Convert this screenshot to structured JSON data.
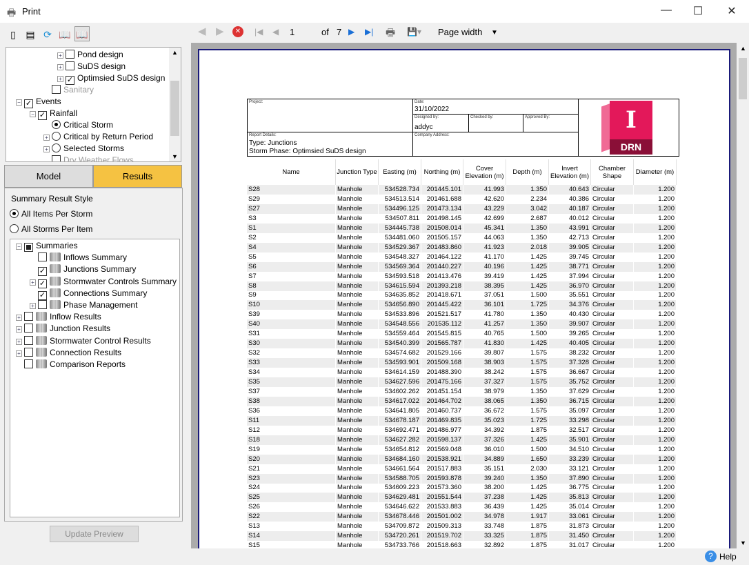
{
  "window": {
    "title": "Print",
    "minimize": "—",
    "maximize": "☐",
    "close": "✕"
  },
  "left_toolbar": {
    "icons": [
      "single-page-icon",
      "multi-page-icon",
      "refresh-icon",
      "book-map-icon",
      "book-icon"
    ]
  },
  "tree_top": [
    {
      "label": "Pond design",
      "checked": false,
      "expandable": true,
      "indent": 3
    },
    {
      "label": "SuDS design",
      "checked": false,
      "expandable": true,
      "indent": 3
    },
    {
      "label": "Optimsied SuDS design",
      "checked": true,
      "expandable": true,
      "indent": 3
    },
    {
      "label": "Sanitary",
      "checked": false,
      "expandable": false,
      "indent": 2,
      "disabled": true
    },
    {
      "label": "Events",
      "checked": true,
      "expandable": true,
      "expanded": true,
      "indent": 0
    },
    {
      "label": "Rainfall",
      "checked": true,
      "expandable": true,
      "expanded": true,
      "indent": 1
    },
    {
      "label": "Critical Storm",
      "radio": true,
      "selected": true,
      "indent": 2
    },
    {
      "label": "Critical by Return Period",
      "radio": true,
      "selected": false,
      "expandable": true,
      "indent": 2
    },
    {
      "label": "Selected Storms",
      "radio": true,
      "selected": false,
      "expandable": true,
      "indent": 2
    },
    {
      "label": "Dry Weather Flows",
      "checked": false,
      "indent": 2,
      "disabled": true
    }
  ],
  "tabs": {
    "model": "Model",
    "results": "Results",
    "active": "results",
    "active_color": "#f5c242"
  },
  "results_panel": {
    "style_label": "Summary Result Style",
    "options": [
      {
        "label": "All Items Per Storm",
        "selected": true
      },
      {
        "label": "All Storms Per Item",
        "selected": false
      }
    ],
    "tree": [
      {
        "label": "Summaries",
        "state": "partial",
        "expandable": true,
        "expanded": true,
        "indent": 0,
        "book": false
      },
      {
        "label": "Inflows Summary",
        "checked": false,
        "indent": 1,
        "book": true
      },
      {
        "label": "Junctions Summary",
        "checked": true,
        "indent": 1,
        "book": true
      },
      {
        "label": "Stormwater Controls Summary",
        "checked": true,
        "expandable": true,
        "indent": 1,
        "book": true
      },
      {
        "label": "Connections Summary",
        "checked": true,
        "indent": 1,
        "book": true
      },
      {
        "label": "Phase Management",
        "checked": false,
        "expandable": true,
        "indent": 1,
        "book": true
      },
      {
        "label": "Inflow Results",
        "checked": false,
        "expandable": true,
        "indent": 0,
        "book": true
      },
      {
        "label": "Junction Results",
        "checked": false,
        "expandable": true,
        "indent": 0,
        "book": true
      },
      {
        "label": "Stormwater Control Results",
        "checked": false,
        "expandable": true,
        "indent": 0,
        "book": true
      },
      {
        "label": "Connection Results",
        "checked": false,
        "expandable": true,
        "indent": 0,
        "book": true
      },
      {
        "label": "Comparison Reports",
        "checked": false,
        "indent": 0,
        "book": true
      }
    ],
    "update_button": "Update Preview"
  },
  "preview_toolbar": {
    "page": "1",
    "of_label": "of",
    "total_pages": "7",
    "zoom": "Page width"
  },
  "report": {
    "project_label": "Project:",
    "date_label": "Date:",
    "date": "31/10/2022",
    "designed_label": "Designed by:",
    "designed": "addyc",
    "checked_label": "Checked by:",
    "approved_label": "Approved By:",
    "details_label": "Report Details:",
    "type": "Type: Junctions",
    "phase": "Storm Phase: Optimsied SuDS design",
    "address_label": "Company Address:",
    "logo_letter": "I",
    "logo_text": "DRN",
    "logo_color": "#e3185a",
    "columns": [
      "Name",
      "Junction Type",
      "Easting (m)",
      "Northing (m)",
      "Cover Elevation (m)",
      "Depth (m)",
      "Invert Elevation (m)",
      "Chamber Shape",
      "Diameter (m)"
    ],
    "rows": [
      [
        "S28",
        "Manhole",
        "534528.734",
        "201445.101",
        "41.993",
        "1.350",
        "40.643",
        "Circular",
        "1.200"
      ],
      [
        "S29",
        "Manhole",
        "534513.514",
        "201461.688",
        "42.620",
        "2.234",
        "40.386",
        "Circular",
        "1.200"
      ],
      [
        "S27",
        "Manhole",
        "534496.125",
        "201473.134",
        "43.229",
        "3.042",
        "40.187",
        "Circular",
        "1.200"
      ],
      [
        "S3",
        "Manhole",
        "534507.811",
        "201498.145",
        "42.699",
        "2.687",
        "40.012",
        "Circular",
        "1.200"
      ],
      [
        "S1",
        "Manhole",
        "534445.738",
        "201508.014",
        "45.341",
        "1.350",
        "43.991",
        "Circular",
        "1.200"
      ],
      [
        "S2",
        "Manhole",
        "534481.060",
        "201505.157",
        "44.063",
        "1.350",
        "42.713",
        "Circular",
        "1.200"
      ],
      [
        "S4",
        "Manhole",
        "534529.367",
        "201483.860",
        "41.923",
        "2.018",
        "39.905",
        "Circular",
        "1.200"
      ],
      [
        "S5",
        "Manhole",
        "534548.327",
        "201464.122",
        "41.170",
        "1.425",
        "39.745",
        "Circular",
        "1.200"
      ],
      [
        "S6",
        "Manhole",
        "534569.364",
        "201440.227",
        "40.196",
        "1.425",
        "38.771",
        "Circular",
        "1.200"
      ],
      [
        "S7",
        "Manhole",
        "534593.518",
        "201413.476",
        "39.419",
        "1.425",
        "37.994",
        "Circular",
        "1.200"
      ],
      [
        "S8",
        "Manhole",
        "534615.594",
        "201393.218",
        "38.395",
        "1.425",
        "36.970",
        "Circular",
        "1.200"
      ],
      [
        "S9",
        "Manhole",
        "534635.852",
        "201418.671",
        "37.051",
        "1.500",
        "35.551",
        "Circular",
        "1.200"
      ],
      [
        "S10",
        "Manhole",
        "534656.890",
        "201445.422",
        "36.101",
        "1.725",
        "34.376",
        "Circular",
        "1.200"
      ],
      [
        "S39",
        "Manhole",
        "534533.896",
        "201521.517",
        "41.780",
        "1.350",
        "40.430",
        "Circular",
        "1.200"
      ],
      [
        "S40",
        "Manhole",
        "534548.556",
        "201535.112",
        "41.257",
        "1.350",
        "39.907",
        "Circular",
        "1.200"
      ],
      [
        "S31",
        "Manhole",
        "534559.464",
        "201545.815",
        "40.765",
        "1.500",
        "39.265",
        "Circular",
        "1.200"
      ],
      [
        "S30",
        "Manhole",
        "534540.399",
        "201565.787",
        "41.830",
        "1.425",
        "40.405",
        "Circular",
        "1.200"
      ],
      [
        "S32",
        "Manhole",
        "534574.682",
        "201529.166",
        "39.807",
        "1.575",
        "38.232",
        "Circular",
        "1.200"
      ],
      [
        "S33",
        "Manhole",
        "534593.901",
        "201509.168",
        "38.903",
        "1.575",
        "37.328",
        "Circular",
        "1.200"
      ],
      [
        "S34",
        "Manhole",
        "534614.159",
        "201488.390",
        "38.242",
        "1.575",
        "36.667",
        "Circular",
        "1.200"
      ],
      [
        "S35",
        "Manhole",
        "534627.596",
        "201475.166",
        "37.327",
        "1.575",
        "35.752",
        "Circular",
        "1.200"
      ],
      [
        "S37",
        "Manhole",
        "534602.262",
        "201451.154",
        "38.979",
        "1.350",
        "37.629",
        "Circular",
        "1.200"
      ],
      [
        "S38",
        "Manhole",
        "534617.022",
        "201464.702",
        "38.065",
        "1.350",
        "36.715",
        "Circular",
        "1.200"
      ],
      [
        "S36",
        "Manhole",
        "534641.805",
        "201460.737",
        "36.672",
        "1.575",
        "35.097",
        "Circular",
        "1.200"
      ],
      [
        "S11",
        "Manhole",
        "534678.187",
        "201469.835",
        "35.023",
        "1.725",
        "33.298",
        "Circular",
        "1.200"
      ],
      [
        "S12",
        "Manhole",
        "534692.471",
        "201486.977",
        "34.392",
        "1.875",
        "32.517",
        "Circular",
        "1.200"
      ],
      [
        "S18",
        "Manhole",
        "534627.282",
        "201598.137",
        "37.326",
        "1.425",
        "35.901",
        "Circular",
        "1.200"
      ],
      [
        "S19",
        "Manhole",
        "534654.812",
        "201569.048",
        "36.010",
        "1.500",
        "34.510",
        "Circular",
        "1.200"
      ],
      [
        "S20",
        "Manhole",
        "534684.160",
        "201538.921",
        "34.889",
        "1.650",
        "33.239",
        "Circular",
        "1.200"
      ],
      [
        "S21",
        "Manhole",
        "534661.564",
        "201517.883",
        "35.151",
        "2.030",
        "33.121",
        "Circular",
        "1.200"
      ],
      [
        "S23",
        "Manhole",
        "534588.705",
        "201593.878",
        "39.240",
        "1.350",
        "37.890",
        "Circular",
        "1.200"
      ],
      [
        "S24",
        "Manhole",
        "534609.223",
        "201573.360",
        "38.200",
        "1.425",
        "36.775",
        "Circular",
        "1.200"
      ],
      [
        "S25",
        "Manhole",
        "534629.481",
        "201551.544",
        "37.238",
        "1.425",
        "35.813",
        "Circular",
        "1.200"
      ],
      [
        "S26",
        "Manhole",
        "534646.622",
        "201533.883",
        "36.439",
        "1.425",
        "35.014",
        "Circular",
        "1.200"
      ],
      [
        "S22",
        "Manhole",
        "534678.446",
        "201501.002",
        "34.978",
        "1.917",
        "33.061",
        "Circular",
        "1.200"
      ],
      [
        "S13",
        "Manhole",
        "534709.872",
        "201509.313",
        "33.748",
        "1.875",
        "31.873",
        "Circular",
        "1.200"
      ],
      [
        "S14",
        "Manhole",
        "534720.261",
        "201519.702",
        "33.325",
        "1.875",
        "31.450",
        "Circular",
        "1.200"
      ],
      [
        "S15",
        "Manhole",
        "534733.766",
        "201518.663",
        "32.892",
        "1.875",
        "31.017",
        "Circular",
        "1.200"
      ]
    ]
  },
  "status": {
    "help": "Help"
  }
}
